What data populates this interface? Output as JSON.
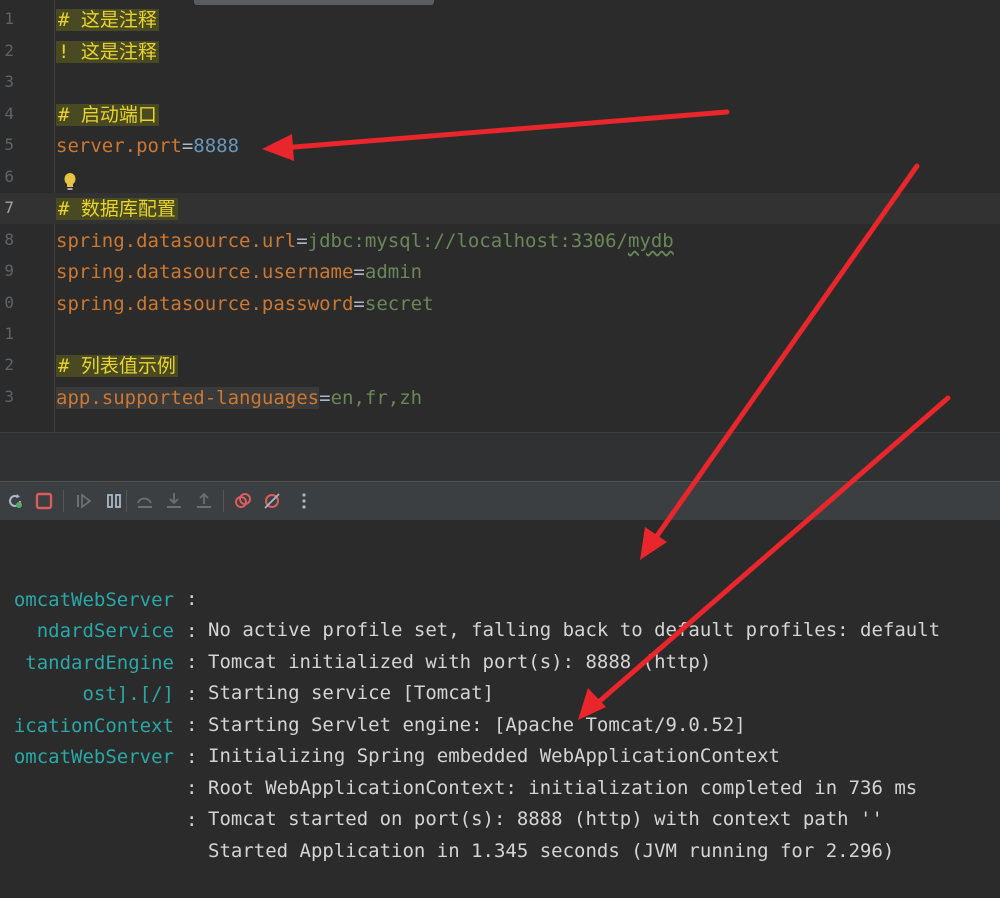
{
  "editor": {
    "lines": [
      {
        "n": "1",
        "comment_marker": "#",
        "comment": "这是注释"
      },
      {
        "n": "2",
        "comment_marker": "!",
        "comment": "这是注释"
      },
      {
        "n": "3"
      },
      {
        "n": "4",
        "comment_marker": "#",
        "comment": "启动端口"
      },
      {
        "n": "5",
        "key": "server.port",
        "eq": "=",
        "value": "8888"
      },
      {
        "n": "6"
      },
      {
        "n": "7",
        "comment_marker": "#",
        "comment": "数据库配置"
      },
      {
        "n": "8",
        "key": "spring.datasource.url",
        "eq": "=",
        "value_a": "jdbc:mysql://localhost:3306/",
        "value_b": "mydb"
      },
      {
        "n": "9",
        "key": "spring.datasource.username",
        "eq": "=",
        "value": "admin"
      },
      {
        "n": "0",
        "key": "spring.datasource.password",
        "eq": "=",
        "value": "secret"
      },
      {
        "n": "1"
      },
      {
        "n": "2",
        "comment_marker": "#",
        "comment": "列表值示例"
      },
      {
        "n": "3",
        "key": "app.supported-languages",
        "eq": "=",
        "value": "en,fr,zh"
      }
    ]
  },
  "console": {
    "lines": [
      {
        "logger": "",
        "msg": "No active profile set, falling back to default profiles: default"
      },
      {
        "logger": "omcatWebServer",
        "msg": "Tomcat initialized with port(s): 8888 (http)"
      },
      {
        "logger": "ndardService",
        "msg": "Starting service [Tomcat]"
      },
      {
        "logger": "tandardEngine",
        "msg": "Starting Servlet engine: [Apache Tomcat/9.0.52]"
      },
      {
        "logger": "ost].[/]",
        "msg": "Initializing Spring embedded WebApplicationContext"
      },
      {
        "logger": "icationContext",
        "msg": "Root WebApplicationContext: initialization completed in 736 ms"
      },
      {
        "logger": "omcatWebServer",
        "msg": "Tomcat started on port(s): 8888 (http) with context path ''"
      },
      {
        "logger": "",
        "msg": "Started Application in 1.345 seconds (JVM running for 2.296)"
      }
    ],
    "colon": ":"
  },
  "colors": {
    "arrow": "#e8262b",
    "logger": "#2aa7a7",
    "key": "#cc7832",
    "number": "#6897bb",
    "string": "#6a8759",
    "comment": "#e8d32f"
  }
}
